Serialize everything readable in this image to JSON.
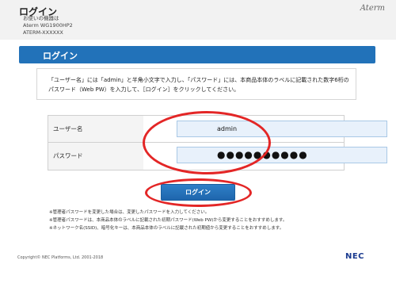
{
  "header": {
    "title": "ログイン",
    "device_caption": "お使いの機器は",
    "model": "Aterm WG1900HP2",
    "ssid_label": "ATERM-XXXXXX",
    "brand": "Aterm"
  },
  "title_bar": {
    "text": "ログイン"
  },
  "instruction": {
    "text": "「ユーザー名」には「admin」と半角小文字で入力し、「パスワード」には、本商品本体のラベルに記載された数字6桁のパスワード（Web PW）を入力して、［ログイン］をクリックしてください。"
  },
  "form": {
    "username_label": "ユーザー名",
    "username_value": "admin",
    "password_label": "パスワード",
    "password_value": "●●●●●●●●●●"
  },
  "login_button": {
    "label": "ログイン"
  },
  "notes": [
    "※管理者パスワードを変更した場合は、変更したパスワードを入力してください。",
    "※管理者パスワードは、本商品本体のラベルに記載された初期パスワード(Web PW)から変更することをおすすめします。",
    "※ネットワーク名(SSID)、暗号化キーは、本商品本体のラベルに記載された初期値から変更することをおすすめします。"
  ],
  "footer": {
    "copyright": "Copyright© NEC Platforms, Ltd. 2001-2018",
    "logo": "NEC"
  },
  "colors": {
    "title_bar": "#2272b9",
    "button": "#1f66ad",
    "annotation_ring": "#e32626",
    "input_bg": "#e8f1fb"
  }
}
